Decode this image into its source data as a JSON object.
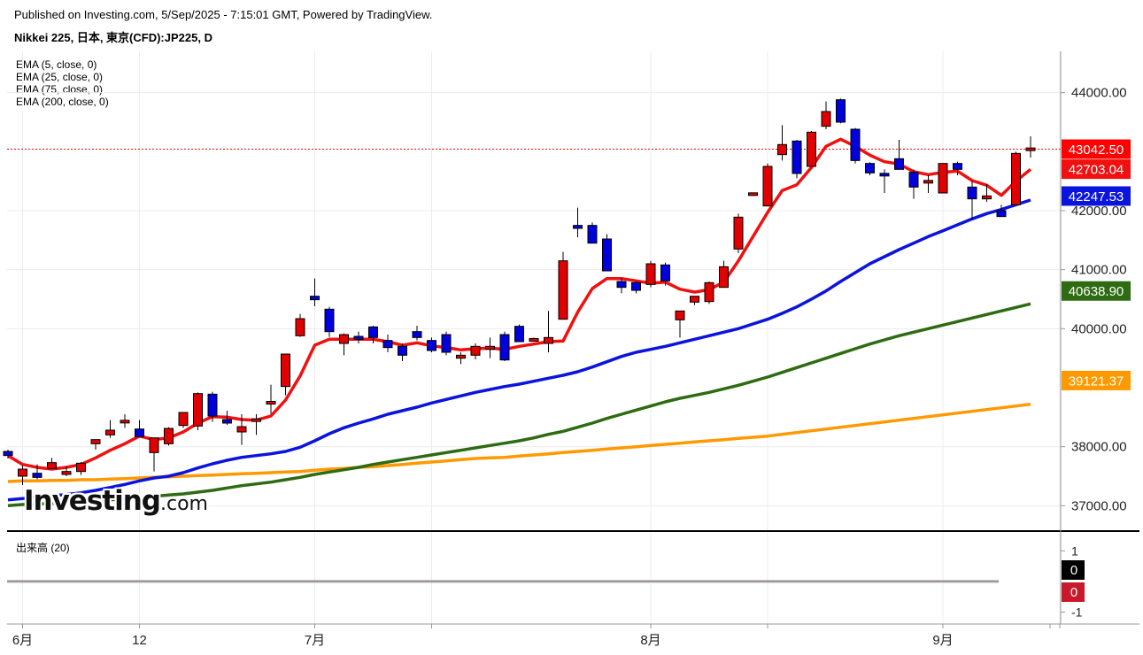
{
  "header": {
    "published": "Published on Investing.com, 5/Sep/2025 - 7:15:01 GMT, Powered by TradingView.",
    "symbol": "Nikkei 225, 日本, 東京(CFD):JP225, D"
  },
  "legend": [
    "EMA (5, close, 0)",
    "EMA (25, close, 0)",
    "EMA (75, close, 0)",
    "EMA (200, close, 0)"
  ],
  "volume_label": "出来高 (20)",
  "watermark": {
    "brand": "Investing",
    "suffix": ".com"
  },
  "colors": {
    "up": "#e00000",
    "down": "#0000dd",
    "ema5": "#f01010",
    "ema25": "#0a14dc",
    "ema75": "#2e6b12",
    "ema200": "#ff9900",
    "last": "#ff0000",
    "grid": "#ececec"
  },
  "chart_data": {
    "type": "candlestick",
    "price_axis": {
      "ylim": [
        36600,
        44700
      ],
      "ticks": [
        37000,
        38000,
        40000,
        41000,
        42000,
        44000
      ],
      "tick_labels": [
        "37000.00",
        "38000.00",
        "40000.00",
        "41000.00",
        "42000.00",
        "44000.00"
      ]
    },
    "x_labels": [
      {
        "label": "6月",
        "index": 1
      },
      {
        "label": "12",
        "index": 9
      },
      {
        "label": "7月",
        "index": 21
      },
      {
        "label": "8月",
        "index": 44
      },
      {
        "label": "9月",
        "index": 64
      }
    ],
    "x_gridlines": [
      1,
      9,
      21,
      29,
      44,
      52,
      64,
      72
    ],
    "price_badges": [
      {
        "label": "43042.50",
        "value": 43042.5,
        "color": "#ff0000"
      },
      {
        "label": "42703.04",
        "value": 42703.04,
        "color": "#f01010"
      },
      {
        "label": "42247.53",
        "value": 42247.53,
        "color": "#0a14dc"
      },
      {
        "label": "40638.90",
        "value": 40638.9,
        "color": "#2e6b12"
      },
      {
        "label": "39121.37",
        "value": 39121.37,
        "color": "#ff9900"
      }
    ],
    "last_price": 43042.5,
    "candles": [
      [
        37920,
        37950,
        37800,
        37850
      ],
      [
        37500,
        37680,
        37350,
        37620
      ],
      [
        37550,
        37700,
        37450,
        37480
      ],
      [
        37630,
        37810,
        37620,
        37730
      ],
      [
        37530,
        37660,
        37500,
        37580
      ],
      [
        37580,
        37740,
        37520,
        37720
      ],
      [
        38050,
        38120,
        37950,
        38120
      ],
      [
        38200,
        38450,
        38150,
        38280
      ],
      [
        38420,
        38550,
        38320,
        38430
      ],
      [
        38300,
        38450,
        38180,
        38170
      ],
      [
        37900,
        38150,
        37580,
        38150
      ],
      [
        38050,
        38330,
        38020,
        38310
      ],
      [
        38360,
        38580,
        38320,
        38580
      ],
      [
        38350,
        38920,
        38280,
        38900
      ],
      [
        38890,
        38930,
        38420,
        38520
      ],
      [
        38460,
        38610,
        38370,
        38400
      ],
      [
        38250,
        38550,
        38030,
        38340
      ],
      [
        38450,
        38550,
        38200,
        38450
      ],
      [
        38740,
        39050,
        38560,
        38750
      ],
      [
        39020,
        39560,
        38870,
        39570
      ],
      [
        39880,
        40250,
        39860,
        40170
      ],
      [
        40550,
        40850,
        40380,
        40490
      ],
      [
        40330,
        40370,
        39860,
        39950
      ],
      [
        39750,
        39920,
        39550,
        39900
      ],
      [
        39870,
        39950,
        39750,
        39820
      ],
      [
        40030,
        40050,
        39750,
        39850
      ],
      [
        39800,
        39900,
        39600,
        39680
      ],
      [
        39700,
        39750,
        39450,
        39550
      ],
      [
        39950,
        40050,
        39800,
        39850
      ],
      [
        39800,
        39850,
        39600,
        39630
      ],
      [
        39900,
        39950,
        39550,
        39600
      ],
      [
        39500,
        39600,
        39400,
        39550
      ],
      [
        39550,
        39750,
        39480,
        39700
      ],
      [
        39650,
        39850,
        39500,
        39700
      ],
      [
        39900,
        39950,
        39450,
        39470
      ],
      [
        40040,
        40070,
        39780,
        39780
      ],
      [
        39800,
        39850,
        39780,
        39820
      ],
      [
        39750,
        40300,
        39600,
        39850
      ],
      [
        40160,
        41300,
        40180,
        41150
      ],
      [
        41750,
        42050,
        41550,
        41700
      ],
      [
        41750,
        41800,
        41500,
        41450
      ],
      [
        41520,
        41600,
        40980,
        40980
      ],
      [
        40800,
        40850,
        40600,
        40700
      ],
      [
        40780,
        40800,
        40600,
        40650
      ],
      [
        40750,
        41150,
        40700,
        41100
      ],
      [
        41080,
        41120,
        40730,
        40810
      ],
      [
        40150,
        40300,
        39850,
        40300
      ],
      [
        40450,
        40500,
        40400,
        40550
      ],
      [
        40460,
        40800,
        40420,
        40780
      ],
      [
        40700,
        41150,
        40750,
        41050
      ],
      [
        41350,
        41950,
        41280,
        41890
      ],
      [
        42280,
        42300,
        42250,
        42280
      ],
      [
        42080,
        42800,
        42080,
        42750
      ],
      [
        42950,
        43450,
        42850,
        43120
      ],
      [
        43180,
        43200,
        42550,
        42630
      ],
      [
        42750,
        43350,
        42800,
        43330
      ],
      [
        43430,
        43850,
        43380,
        43680
      ],
      [
        43880,
        43900,
        43480,
        43500
      ],
      [
        43380,
        43400,
        42800,
        42850
      ],
      [
        42800,
        42820,
        42600,
        42640
      ],
      [
        42620,
        42700,
        42300,
        42600
      ],
      [
        42880,
        43200,
        42750,
        42700
      ],
      [
        42650,
        42700,
        42200,
        42400
      ],
      [
        42480,
        42600,
        42300,
        42500
      ],
      [
        42300,
        42800,
        42300,
        42800
      ],
      [
        42800,
        42830,
        42600,
        42700
      ],
      [
        42400,
        42500,
        41850,
        42200
      ],
      [
        42200,
        42450,
        42150,
        42250
      ],
      [
        42000,
        42100,
        41900,
        41900
      ],
      [
        42100,
        43000,
        42100,
        42970
      ],
      [
        43040,
        43260,
        42900,
        43040
      ]
    ],
    "ema": [
      {
        "period": 5,
        "values": [
          37850,
          37700,
          37650,
          37620,
          37650,
          37700,
          37810,
          37940,
          38050,
          38180,
          38120,
          38150,
          38250,
          38400,
          38510,
          38500,
          38460,
          38450,
          38520,
          38790,
          39200,
          39720,
          39820,
          39820,
          39820,
          39820,
          39780,
          39720,
          39760,
          39710,
          39680,
          39640,
          39660,
          39670,
          39650,
          39700,
          39740,
          39780,
          39790,
          40280,
          40680,
          40850,
          40850,
          40810,
          40770,
          40790,
          40670,
          40620,
          40660,
          40790,
          41150,
          41560,
          41970,
          42340,
          42440,
          42730,
          43090,
          43210,
          43090,
          42940,
          42830,
          42790,
          42660,
          42610,
          42650,
          42670,
          42510,
          42430,
          42260,
          42500,
          42700
        ]
      },
      {
        "period": 25,
        "values": [
          37100,
          37120,
          37150,
          37170,
          37190,
          37220,
          37260,
          37310,
          37360,
          37420,
          37470,
          37500,
          37560,
          37640,
          37710,
          37770,
          37820,
          37850,
          37880,
          37920,
          37990,
          38100,
          38220,
          38320,
          38400,
          38470,
          38550,
          38610,
          38670,
          38740,
          38800,
          38860,
          38920,
          38970,
          39020,
          39060,
          39110,
          39160,
          39210,
          39270,
          39350,
          39440,
          39530,
          39600,
          39650,
          39700,
          39760,
          39820,
          39880,
          39940,
          40000,
          40080,
          40160,
          40260,
          40370,
          40500,
          40640,
          40800,
          40950,
          41100,
          41220,
          41340,
          41450,
          41560,
          41660,
          41760,
          41860,
          41950,
          42020,
          42100,
          42180
        ]
      },
      {
        "period": 75,
        "values": [
          37000,
          37020,
          37030,
          37040,
          37050,
          37060,
          37080,
          37100,
          37120,
          37140,
          37160,
          37180,
          37200,
          37230,
          37260,
          37300,
          37340,
          37370,
          37400,
          37440,
          37480,
          37530,
          37570,
          37610,
          37650,
          37700,
          37740,
          37780,
          37820,
          37860,
          37900,
          37940,
          37980,
          38020,
          38060,
          38100,
          38150,
          38210,
          38260,
          38330,
          38400,
          38480,
          38550,
          38620,
          38690,
          38760,
          38820,
          38870,
          38920,
          38980,
          39040,
          39110,
          39180,
          39260,
          39340,
          39420,
          39500,
          39580,
          39660,
          39740,
          39810,
          39880,
          39940,
          40000,
          40060,
          40120,
          40180,
          40240,
          40300,
          40360,
          40420
        ]
      },
      {
        "period": 200,
        "values": [
          37410,
          37420,
          37420,
          37430,
          37430,
          37440,
          37440,
          37450,
          37460,
          37470,
          37480,
          37490,
          37500,
          37510,
          37520,
          37530,
          37540,
          37550,
          37560,
          37570,
          37580,
          37600,
          37620,
          37630,
          37650,
          37660,
          37680,
          37700,
          37720,
          37740,
          37760,
          37780,
          37800,
          37810,
          37820,
          37840,
          37860,
          37880,
          37900,
          37920,
          37940,
          37960,
          37980,
          38000,
          38020,
          38040,
          38060,
          38080,
          38100,
          38120,
          38140,
          38160,
          38180,
          38210,
          38240,
          38270,
          38300,
          38330,
          38360,
          38390,
          38420,
          38450,
          38480,
          38510,
          38540,
          38570,
          38600,
          38630,
          38660,
          38690,
          38720
        ]
      }
    ],
    "volume": {
      "label": "出来高 (20)",
      "ticks": [
        1,
        -1
      ],
      "ylim": [
        -1.3,
        1.3
      ],
      "values": [
        0,
        0
      ],
      "badges": [
        {
          "label": "0",
          "color": "#000000"
        },
        {
          "label": "0",
          "color": "#c8182a"
        }
      ]
    }
  }
}
